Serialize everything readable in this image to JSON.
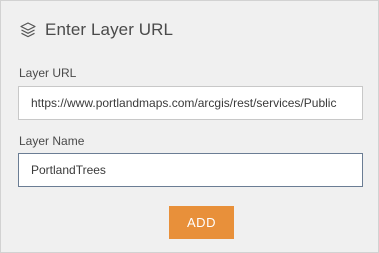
{
  "dialog": {
    "title": "Enter Layer URL",
    "title_icon": "layers-icon"
  },
  "form": {
    "layer_url": {
      "label": "Layer URL",
      "value": "https://www.portlandmaps.com/arcgis/rest/services/Public"
    },
    "layer_name": {
      "label": "Layer Name",
      "value": "PortlandTrees"
    },
    "add_button_label": "ADD"
  },
  "colors": {
    "accent": "#e8903a",
    "panel_background": "#f0f0f0",
    "text": "#4a4a4a",
    "focused_border": "#6b7d94"
  }
}
